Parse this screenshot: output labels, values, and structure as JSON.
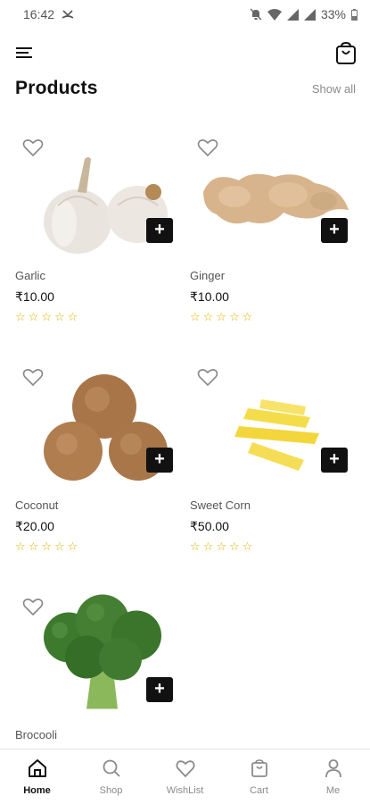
{
  "status_bar": {
    "time": "16:42",
    "battery": "33%"
  },
  "header": {
    "title": "Products",
    "show_all_label": "Show all"
  },
  "products": [
    {
      "name": "Garlic",
      "price": "₹10.00",
      "rating": 0
    },
    {
      "name": "Ginger",
      "price": "₹10.00",
      "rating": 0
    },
    {
      "name": "Coconut",
      "price": "₹20.00",
      "rating": 0
    },
    {
      "name": "Sweet Corn",
      "price": "₹50.00",
      "rating": 0
    },
    {
      "name": "Brocooli",
      "price": "",
      "rating": 0
    }
  ],
  "bottom_nav": [
    {
      "label": "Home",
      "icon": "home-icon",
      "active": true
    },
    {
      "label": "Shop",
      "icon": "search-icon",
      "active": false
    },
    {
      "label": "WishList",
      "icon": "heart-icon",
      "active": false
    },
    {
      "label": "Cart",
      "icon": "bag-icon",
      "active": false
    },
    {
      "label": "Me",
      "icon": "person-icon",
      "active": false
    }
  ],
  "colors": {
    "star": "#e0b100",
    "add_button": "#111111",
    "accent_text": "#111111",
    "muted_text": "#8a8a8a"
  }
}
